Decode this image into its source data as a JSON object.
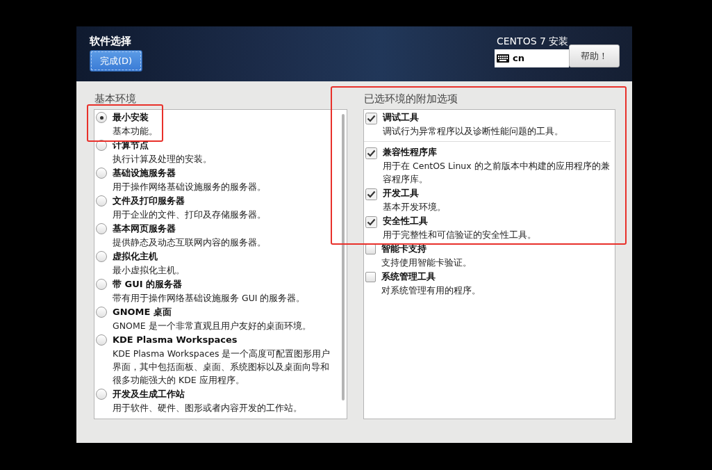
{
  "header": {
    "title": "软件选择",
    "done_button": "完成(D)",
    "product": "CENTOS 7 安装",
    "keyboard": "cn",
    "help_button": "帮助！"
  },
  "base_environment": {
    "heading": "基本环境",
    "items": [
      {
        "name": "最小安装",
        "description": "基本功能。",
        "selected": true
      },
      {
        "name": "计算节点",
        "description": "执行计算及处理的安装。",
        "selected": false
      },
      {
        "name": "基础设施服务器",
        "description": "用于操作网络基础设施服务的服务器。",
        "selected": false
      },
      {
        "name": "文件及打印服务器",
        "description": "用于企业的文件、打印及存储服务器。",
        "selected": false
      },
      {
        "name": "基本网页服务器",
        "description": "提供静态及动态互联网内容的服务器。",
        "selected": false
      },
      {
        "name": "虚拟化主机",
        "description": "最小虚拟化主机。",
        "selected": false
      },
      {
        "name": "带 GUI 的服务器",
        "description": "带有用于操作网络基础设施服务 GUI 的服务器。",
        "selected": false
      },
      {
        "name": "GNOME 桌面",
        "description": "GNOME 是一个非常直观且用户友好的桌面环境。",
        "selected": false
      },
      {
        "name": "KDE Plasma Workspaces",
        "description": "KDE Plasma Workspaces 是一个高度可配置图形用户界面，其中包括面板、桌面、系统图标以及桌面向导和很多功能强大的 KDE 应用程序。",
        "selected": false
      },
      {
        "name": "开发及生成工作站",
        "description": "用于软件、硬件、图形或者内容开发的工作站。",
        "selected": false
      }
    ]
  },
  "addons": {
    "heading": "已选环境的附加选项",
    "items": [
      {
        "name": "调试工具",
        "description": "调试行为异常程序以及诊断性能问题的工具。",
        "checked": true,
        "separator_below": true
      },
      {
        "name": "兼容性程序库",
        "description": "用于在 CentOS Linux 的之前版本中构建的应用程序的兼容程序库。",
        "checked": true,
        "separator_below": false
      },
      {
        "name": "开发工具",
        "description": "基本开发环境。",
        "checked": true,
        "separator_below": false
      },
      {
        "name": "安全性工具",
        "description": "用于完整性和可信验证的安全性工具。",
        "checked": true,
        "separator_below": false
      },
      {
        "name": "智能卡支持",
        "description": "支持使用智能卡验证。",
        "checked": false,
        "separator_below": false
      },
      {
        "name": "系统管理工具",
        "description": "对系统管理有用的程序。",
        "checked": false,
        "separator_below": false
      }
    ]
  }
}
